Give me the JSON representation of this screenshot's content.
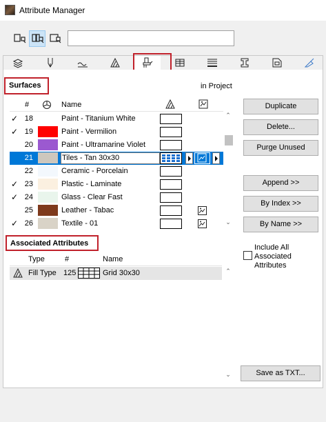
{
  "window": {
    "title": "Attribute Manager"
  },
  "search": {
    "value": "",
    "placeholder": ""
  },
  "view_buttons": [
    "list-view-icon",
    "split-view-icon",
    "detail-view-icon"
  ],
  "tabs": [
    {
      "icon": "layers-icon",
      "active": false
    },
    {
      "icon": "pen-icon",
      "active": false
    },
    {
      "icon": "line-type-icon",
      "active": false
    },
    {
      "icon": "fill-type-icon",
      "active": false
    },
    {
      "icon": "surface-icon",
      "active": true
    },
    {
      "icon": "building-material-icon",
      "active": false
    },
    {
      "icon": "composite-icon",
      "active": false
    },
    {
      "icon": "profile-icon",
      "active": false
    },
    {
      "icon": "zone-category-icon",
      "active": false
    },
    {
      "icon": "mep-icon",
      "active": false
    }
  ],
  "surfaces": {
    "label": "Surfaces",
    "scope": "in Project",
    "columns": {
      "num": "#",
      "name": "Name"
    },
    "rows": [
      {
        "checked": true,
        "num": "18",
        "color": "#ffffff",
        "name": "Paint - Titanium White"
      },
      {
        "checked": true,
        "num": "19",
        "color": "#ff0000",
        "name": "Paint - Vermilion"
      },
      {
        "checked": false,
        "num": "20",
        "color": "#9b59d0",
        "name": "Paint - Ultramarine Violet"
      },
      {
        "checked": false,
        "num": "21",
        "color": "#cdc7bd",
        "name": "Tiles - Tan 30x30",
        "selected": true
      },
      {
        "checked": false,
        "num": "22",
        "color": "#f3f8fd",
        "name": "Ceramic - Porcelain"
      },
      {
        "checked": true,
        "num": "23",
        "color": "#fbf0e0",
        "name": "Plastic - Laminate"
      },
      {
        "checked": true,
        "num": "24",
        "color": "#e9f5ec",
        "name": "Glass - Clear Fast"
      },
      {
        "checked": false,
        "num": "25",
        "color": "#7e3a1c",
        "name": "Leather - Tabac",
        "texture": true
      },
      {
        "checked": true,
        "num": "26",
        "color": "#d9d3c7",
        "name": "Textile - 01",
        "texture": true
      }
    ]
  },
  "associated": {
    "label": "Associated Attributes",
    "columns": {
      "type": "Type",
      "num": "#",
      "name": "Name"
    },
    "rows": [
      {
        "type": "Fill Type",
        "num": "125",
        "name": "Grid 30x30"
      }
    ]
  },
  "buttons": {
    "duplicate": "Duplicate",
    "delete": "Delete...",
    "purge": "Purge Unused",
    "append": "Append >>",
    "by_index": "By Index >>",
    "by_name": "By Name >>",
    "save_txt": "Save as TXT..."
  },
  "include_all": {
    "label": "Include All Associated Attributes",
    "checked": false
  }
}
